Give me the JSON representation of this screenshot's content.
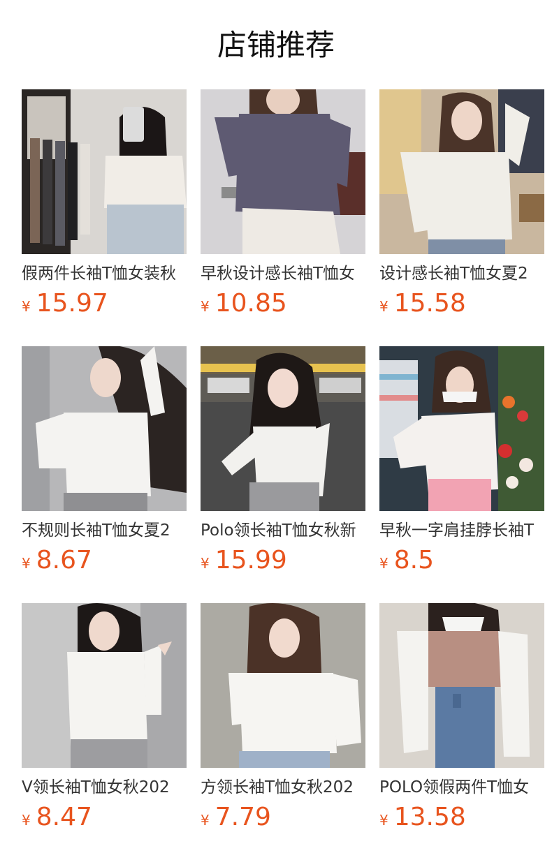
{
  "header": {
    "title": "店铺推荐"
  },
  "currency": "¥",
  "products": [
    {
      "name": "假两件长袖T恤女装秋",
      "price": "15.97"
    },
    {
      "name": "早秋设计感长袖T恤女",
      "price": "10.85"
    },
    {
      "name": "设计感长袖T恤女夏2",
      "price": "15.58"
    },
    {
      "name": "不规则长袖T恤女夏2",
      "price": "8.67"
    },
    {
      "name": "Polo领长袖T恤女秋新",
      "price": "15.99"
    },
    {
      "name": "早秋一字肩挂脖长袖T",
      "price": "8.5"
    },
    {
      "name": "V领长袖T恤女秋202",
      "price": "8.47"
    },
    {
      "name": "方领长袖T恤女秋202",
      "price": "7.79"
    },
    {
      "name": "POLO领假两件T恤女",
      "price": "13.58"
    }
  ]
}
